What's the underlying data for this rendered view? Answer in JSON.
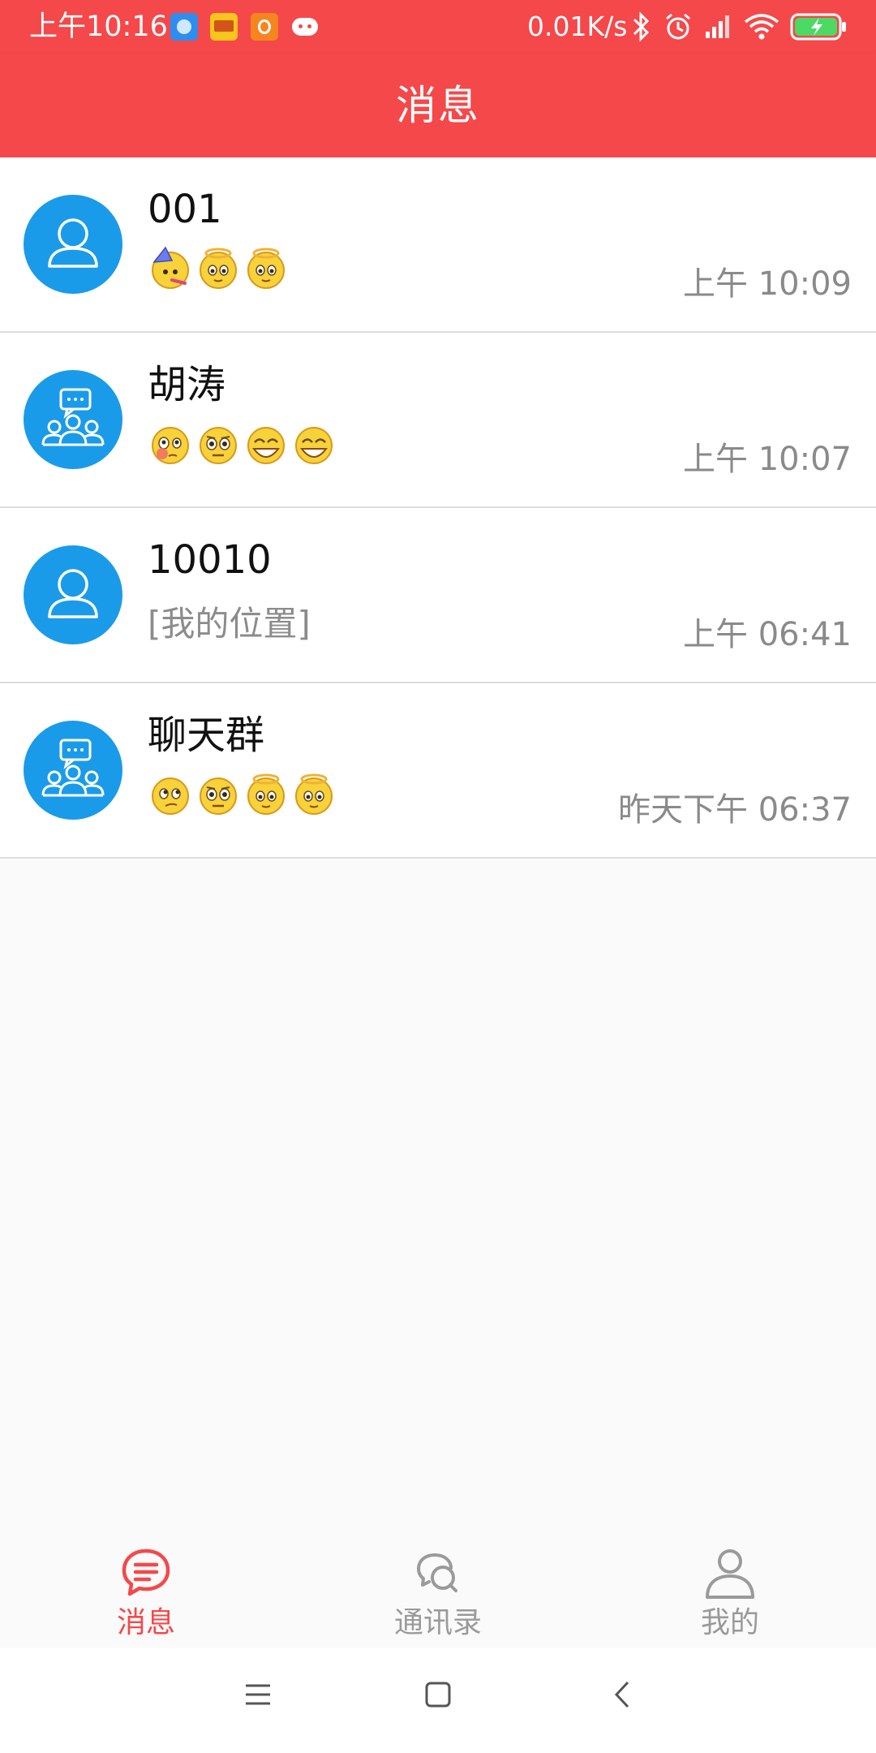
{
  "status_bar": {
    "time": "上午10:16",
    "network_speed": "0.01K/s",
    "notification_icons": [
      "browser-app-icon",
      "news-app-icon",
      "uc-browser-icon",
      "game-app-icon"
    ],
    "system_icons": [
      "bluetooth-icon",
      "alarm-icon",
      "signal-icon",
      "wifi-icon",
      "battery-charging-icon"
    ]
  },
  "header": {
    "title": "消息"
  },
  "conversations": [
    {
      "name": "001",
      "avatar": "person-avatar-icon",
      "preview_emojis": [
        "party-emoji",
        "angel-emoji",
        "angel-emoji"
      ],
      "preview_text": "",
      "time": "上午 10:09"
    },
    {
      "name": "胡涛",
      "avatar": "group-avatar-icon",
      "preview_emojis": [
        "blush-emoji",
        "stare-emoji",
        "grin-emoji",
        "grin-emoji"
      ],
      "preview_text": "",
      "time": "上午 10:07"
    },
    {
      "name": "10010",
      "avatar": "person-avatar-icon",
      "preview_emojis": [],
      "preview_text": "[我的位置]",
      "time": "上午 06:41"
    },
    {
      "name": "聊天群",
      "avatar": "group-avatar-icon",
      "preview_emojis": [
        "thinking-emoji",
        "stare-emoji",
        "angel-emoji",
        "angel-emoji"
      ],
      "preview_text": "",
      "time": "昨天下午 06:37"
    }
  ],
  "bottom_nav": {
    "tabs": [
      {
        "label": "消息",
        "icon": "chat-bubble-icon",
        "active": true
      },
      {
        "label": "通讯录",
        "icon": "contacts-chat-icon",
        "active": false
      },
      {
        "label": "我的",
        "icon": "profile-icon",
        "active": false
      }
    ],
    "active_color": "#f5484a",
    "inactive_color": "#9a9a9a"
  },
  "system_nav": {
    "buttons": [
      "menu-icon",
      "home-icon",
      "back-icon"
    ]
  },
  "colors": {
    "accent": "#f5484a",
    "avatar_bg": "#1a9be9"
  }
}
